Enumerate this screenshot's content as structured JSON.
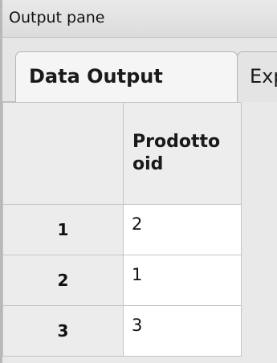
{
  "pane": {
    "title": "Output pane"
  },
  "tabs": [
    {
      "label": "Data Output",
      "active": true
    },
    {
      "label": "Explain",
      "active": false
    }
  ],
  "grid": {
    "columns": [
      {
        "line1": "Prodotto",
        "line2": "oid"
      }
    ],
    "rows": [
      {
        "index": "1",
        "values": [
          "2"
        ]
      },
      {
        "index": "2",
        "values": [
          "1"
        ]
      },
      {
        "index": "3",
        "values": [
          "3"
        ]
      }
    ]
  }
}
